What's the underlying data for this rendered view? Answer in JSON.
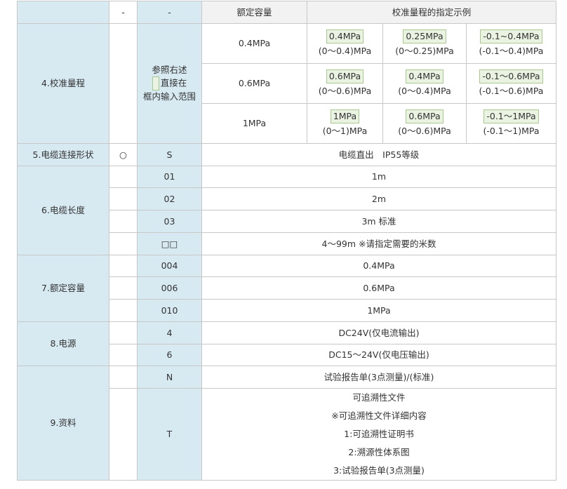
{
  "header": {
    "col2": "-",
    "col3": "-",
    "capacity": "额定容量",
    "range_example": "校准量程的指定示例"
  },
  "range": {
    "category": "4.校准量程",
    "note_line1": "参照右述",
    "note_line2": "直接在",
    "note_line3": "框内输入范围",
    "rows": [
      {
        "capacity": "0.4MPa",
        "examples": [
          {
            "box": "0.4MPa",
            "range": "(0～0.4)MPa"
          },
          {
            "box": "0.25MPa",
            "range": "(0～0.25)MPa"
          },
          {
            "box": "-0.1~0.4MPa",
            "range": "(-0.1～0.4)MPa"
          }
        ]
      },
      {
        "capacity": "0.6MPa",
        "examples": [
          {
            "box": "0.6MPa",
            "range": "(0～0.6)MPa"
          },
          {
            "box": "0.4MPa",
            "range": "(0～0.4)MPa"
          },
          {
            "box": "-0.1～0.6MPa",
            "range": "(-0.1～0.6)MPa"
          }
        ]
      },
      {
        "capacity": "1MPa",
        "examples": [
          {
            "box": "1MPa",
            "range": "(0～1)MPa"
          },
          {
            "box": "0.6MPa",
            "range": "(0～0.6)MPa"
          },
          {
            "box": "-0.1～1MPa",
            "range": "(-0.1～1)MPa"
          }
        ]
      }
    ]
  },
  "cable_connection": {
    "category": "5.电缆连接形状",
    "mark": "○",
    "code": "S",
    "desc": "电缆直出　IP55等级"
  },
  "cable_length": {
    "category": "6.电缆长度",
    "rows": [
      {
        "code": "01",
        "desc": "1m"
      },
      {
        "code": "02",
        "desc": "2m"
      },
      {
        "code": "03",
        "desc": "3m 标准"
      },
      {
        "code": "□□",
        "desc": "4～99m ※请指定需要的米数"
      }
    ]
  },
  "rated_capacity": {
    "category": "7.额定容量",
    "rows": [
      {
        "code": "004",
        "desc": "0.4MPa"
      },
      {
        "code": "006",
        "desc": "0.6MPa"
      },
      {
        "code": "010",
        "desc": "1MPa"
      }
    ]
  },
  "power": {
    "category": "8.电源",
    "rows": [
      {
        "code": "4",
        "desc": "DC24V(仅电流输出)"
      },
      {
        "code": "6",
        "desc": "DC15～24V(仅电压输出)"
      }
    ]
  },
  "documents": {
    "category": "9.资料",
    "rows": [
      {
        "code": "N",
        "lines": [
          "试验报告单(3点测量)/(标准)"
        ]
      },
      {
        "code": "T",
        "lines": [
          "可追溯性文件",
          "※可追溯性文件详细内容",
          "1:可追溯性证明书",
          "2:溯源性体系图",
          "3:试验报告单(3点测量)"
        ]
      }
    ]
  }
}
